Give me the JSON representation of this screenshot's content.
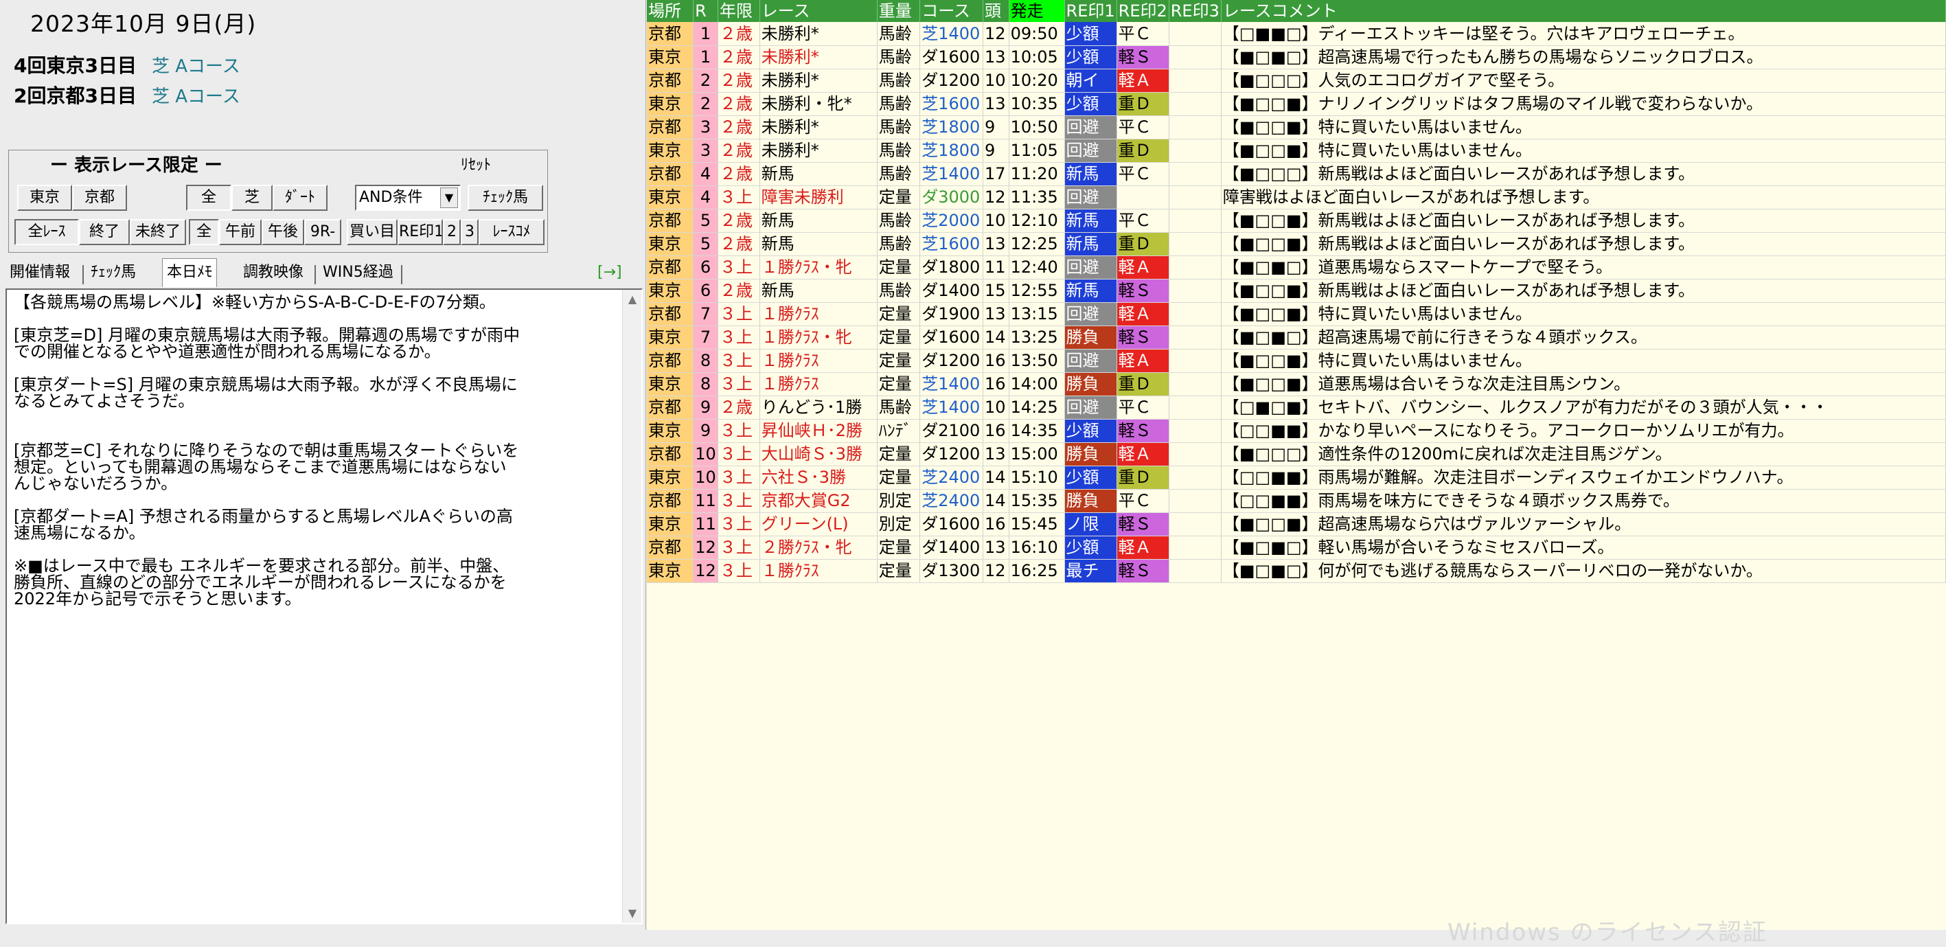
{
  "left_panel": {
    "date": "2023年10月 9日(月)",
    "venues": [
      {
        "label": "4回東京3日目",
        "course": "芝 Aコース"
      },
      {
        "label": "2回京都3日目",
        "course": "芝 Aコース"
      }
    ],
    "filter": {
      "title": "ー  表示レース限定  ー",
      "reset_label": "ﾘｾｯﾄ",
      "venue_buttons": [
        "東京",
        "京都"
      ],
      "surface_buttons": [
        "全",
        "芝",
        "ﾀﾞｰﾄ"
      ],
      "condition_select": "AND条件",
      "check_horse_button": "ﾁｪｯｸ馬",
      "race_buttons": [
        "全ﾚｰｽ",
        "終了",
        "未終了"
      ],
      "time_buttons": [
        "全",
        "午前",
        "午後",
        "9R-"
      ],
      "extra_buttons": [
        "買い目",
        "RE印1",
        "2",
        "3",
        "ﾚｰｽｺﾒ"
      ]
    },
    "tabs": [
      "開催情報",
      "ﾁｪｯｸ馬",
      "本日ﾒﾓ",
      "調教映像",
      "WIN5経過"
    ],
    "active_tab": "本日ﾒﾓ",
    "arrow_button": "[→]",
    "memo_text": "【各競馬場の馬場レベル】※軽い方からS-A-B-C-D-E-Fの7分類。\n\n[東京芝=D] 月曜の東京競馬場は大雨予報。開幕週の馬場ですが雨中\nでの開催となるとやや道悪適性が問われる馬場になるか。\n\n[東京ダート=S] 月曜の東京競馬場は大雨予報。水が浮く不良馬場に\nなるとみてよさそうだ。\n\n\n[京都芝=C] それなりに降りそうなので朝は重馬場スタートぐらいを\n想定。といっても開幕週の馬場ならそこまで道悪馬場にはならない\nんじゃないだろうか。\n\n[京都ダート=A] 予想される雨量からすると馬場レベルAぐらいの高\n速馬場になるか。\n\n※■はレース中で最も エネルギーを要求される部分。前半、中盤、\n勝負所、直線のどの部分でエネルギーが問われるレースになるかを\n2022年から記号で示そうと思います。"
  },
  "race_table": {
    "columns": [
      "場所",
      "R",
      "年限",
      "レース",
      "重量",
      "コース",
      "頭",
      "発走",
      "RE印1",
      "RE印2",
      "RE印3",
      "レースコメント"
    ],
    "rows": [
      [
        "京都",
        "1",
        "２歳",
        "未勝利*",
        "馬齢",
        "芝1400",
        "12",
        "09:50",
        "少額",
        "平Ｃ",
        "",
        "【□■■□】ディーエストッキーは堅そう。穴はキアロヴェローチェ。"
      ],
      [
        "東京",
        "1",
        "２歳",
        "未勝利*",
        "馬齢",
        "ダ1600",
        "13",
        "10:05",
        "少額",
        "軽Ｓ",
        "",
        "【■□■□】超高速馬場で行ったもん勝ちの馬場ならソニックロブロス。"
      ],
      [
        "京都",
        "2",
        "２歳",
        "未勝利*",
        "馬齢",
        "ダ1200",
        "10",
        "10:20",
        "朝イ",
        "軽Ａ",
        "",
        "【■□□□】人気のエコログガイアで堅そう。"
      ],
      [
        "東京",
        "2",
        "２歳",
        "未勝利・牝*",
        "馬齢",
        "芝1600",
        "13",
        "10:35",
        "少額",
        "重Ｄ",
        "",
        "【■□□■】ナリノイングリッドはタフ馬場のマイル戦で変わらないか。"
      ],
      [
        "京都",
        "3",
        "２歳",
        "未勝利*",
        "馬齢",
        "芝1800",
        "9",
        "10:50",
        "回避",
        "平Ｃ",
        "",
        "【■□□■】特に買いたい馬はいません。"
      ],
      [
        "東京",
        "3",
        "２歳",
        "未勝利*",
        "馬齢",
        "芝1800",
        "9",
        "11:05",
        "回避",
        "重Ｄ",
        "",
        "【■□□■】特に買いたい馬はいません。"
      ],
      [
        "京都",
        "4",
        "２歳",
        "新馬",
        "馬齢",
        "芝1400",
        "17",
        "11:20",
        "新馬",
        "平Ｃ",
        "",
        "【■□□□】新馬戦はよほど面白いレースがあれば予想します。"
      ],
      [
        "東京",
        "4",
        "３上",
        "障害未勝利",
        "定量",
        "ダ3000",
        "12",
        "11:35",
        "回避",
        "",
        "",
        "障害戦はよほど面白いレースがあれば予想します。"
      ],
      [
        "京都",
        "5",
        "２歳",
        "新馬",
        "馬齢",
        "芝2000",
        "10",
        "12:10",
        "新馬",
        "平Ｃ",
        "",
        "【■□□■】新馬戦はよほど面白いレースがあれば予想します。"
      ],
      [
        "東京",
        "5",
        "２歳",
        "新馬",
        "馬齢",
        "芝1600",
        "13",
        "12:25",
        "新馬",
        "重Ｄ",
        "",
        "【■□□■】新馬戦はよほど面白いレースがあれば予想します。"
      ],
      [
        "京都",
        "6",
        "３上",
        "１勝ｸﾗｽ・牝",
        "定量",
        "ダ1800",
        "11",
        "12:40",
        "回避",
        "軽Ａ",
        "",
        "【■□■□】道悪馬場ならスマートケープで堅そう。"
      ],
      [
        "東京",
        "6",
        "２歳",
        "新馬",
        "馬齢",
        "ダ1400",
        "15",
        "12:55",
        "新馬",
        "軽Ｓ",
        "",
        "【■□□■】新馬戦はよほど面白いレースがあれば予想します。"
      ],
      [
        "京都",
        "7",
        "３上",
        "１勝ｸﾗｽ",
        "定量",
        "ダ1900",
        "13",
        "13:15",
        "回避",
        "軽Ａ",
        "",
        "【■□□■】特に買いたい馬はいません。"
      ],
      [
        "東京",
        "7",
        "３上",
        "１勝ｸﾗｽ・牝",
        "定量",
        "ダ1600",
        "14",
        "13:25",
        "勝負",
        "軽Ｓ",
        "",
        "【■□■□】超高速馬場で前に行きそうな４頭ボックス。"
      ],
      [
        "京都",
        "8",
        "３上",
        "１勝ｸﾗｽ",
        "定量",
        "ダ1200",
        "16",
        "13:50",
        "回避",
        "軽Ａ",
        "",
        "【■□□■】特に買いたい馬はいません。"
      ],
      [
        "東京",
        "8",
        "３上",
        "１勝ｸﾗｽ",
        "定量",
        "芝1400",
        "16",
        "14:00",
        "勝負",
        "重Ｄ",
        "",
        "【■□□■】道悪馬場は合いそうな次走注目馬シウン。"
      ],
      [
        "京都",
        "9",
        "２歳",
        "りんどう･1勝",
        "馬齢",
        "芝1400",
        "10",
        "14:25",
        "回避",
        "平Ｃ",
        "",
        "【□■□■】セキトバ、バウンシー、ルクスノアが有力だがその３頭が人気・・・"
      ],
      [
        "東京",
        "9",
        "３上",
        "昇仙峡Ｈ･2勝",
        "ﾊﾝﾃﾞ",
        "ダ2100",
        "16",
        "14:35",
        "少額",
        "軽Ｓ",
        "",
        "【□□■■】かなり早いペースになりそう。アコークローかソムリエが有力。"
      ],
      [
        "京都",
        "10",
        "３上",
        "大山崎Ｓ･3勝",
        "定量",
        "ダ1200",
        "13",
        "15:00",
        "勝負",
        "軽Ａ",
        "",
        "【■□□□】適性条件の1200mに戻れば次走注目馬ジゲン。"
      ],
      [
        "東京",
        "10",
        "３上",
        "六社Ｓ･3勝",
        "定量",
        "芝2400",
        "14",
        "15:10",
        "少額",
        "重Ｄ",
        "",
        "【□□■■】雨馬場が難解。次走注目ボーンディスウェイかエンドウノハナ。"
      ],
      [
        "京都",
        "11",
        "３上",
        "京都大賞G2",
        "別定",
        "芝2400",
        "14",
        "15:35",
        "勝負",
        "平Ｃ",
        "",
        "【□□■■】雨馬場を味方にできそうな４頭ボックス馬券で。"
      ],
      [
        "東京",
        "11",
        "３上",
        "グリーン(L)",
        "別定",
        "ダ1600",
        "16",
        "15:45",
        "ノ限",
        "軽Ｓ",
        "",
        "【■□□■】超高速馬場なら穴はヴァルツァーシャル。"
      ],
      [
        "京都",
        "12",
        "３上",
        "２勝ｸﾗｽ・牝",
        "定量",
        "ダ1400",
        "13",
        "16:10",
        "少額",
        "軽Ａ",
        "",
        "【■□■□】軽い馬場が合いそうなミセスバローズ。"
      ],
      [
        "東京",
        "12",
        "３上",
        "１勝ｸﾗｽ",
        "定量",
        "ダ1300",
        "12",
        "16:25",
        "最チ",
        "軽Ｓ",
        "",
        "【■□■□】何が何でも逃げる競馬ならスーパーリベロの一発がないか。"
      ]
    ]
  },
  "watermark": "Windows のライセンス認証"
}
